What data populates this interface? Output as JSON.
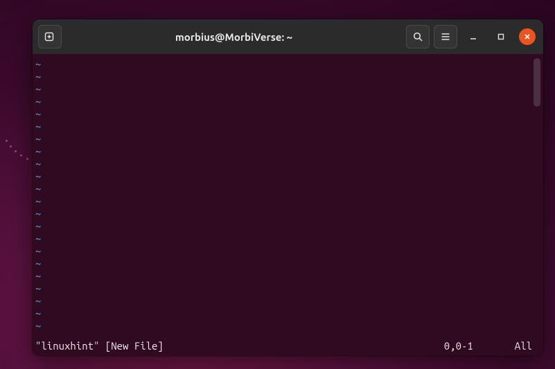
{
  "window": {
    "title": "morbius@MorbiVerse: ~"
  },
  "titlebar": {
    "new_tab_icon": "new-tab-icon",
    "search_icon": "search-icon",
    "menu_icon": "hamburger-icon",
    "minimize_icon": "minimize-icon",
    "maximize_icon": "maximize-icon",
    "close_icon": "close-icon"
  },
  "editor": {
    "empty_first_line": "",
    "tilde": "~",
    "tilde_line_count": 22,
    "status_filename": "\"linuxhint\" [New File]",
    "status_position": "0,0-1",
    "status_view": "All"
  },
  "colors": {
    "accent": "#E95420",
    "tilde": "#6aa8e8",
    "bg": "#2f0a20",
    "headerbar": "#2b2b2b"
  }
}
